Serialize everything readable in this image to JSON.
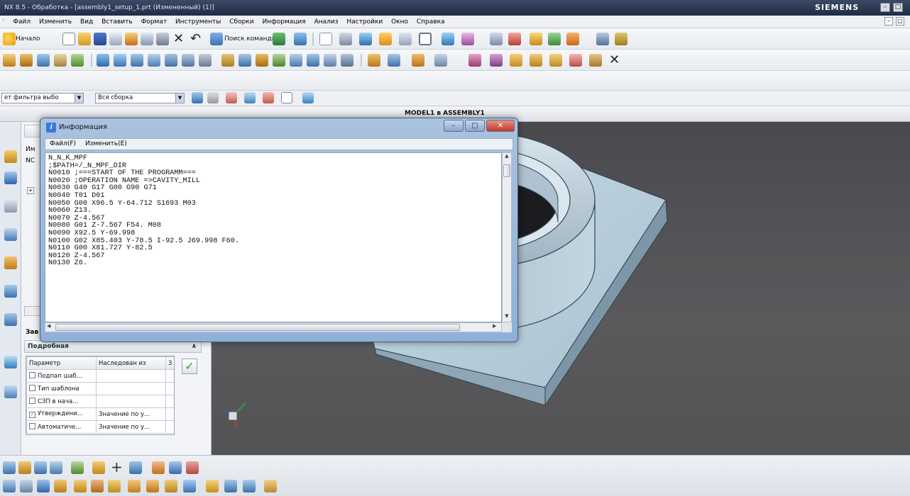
{
  "window": {
    "title": "NX 8.5 - Обработка - [assembly1_setup_1.prt (Измененный)  (1)]",
    "brand": "SIEMENS",
    "min_glyph": "–",
    "close_glyph": "✕",
    "restore_glyph": "□"
  },
  "menu": {
    "items": [
      "Файл",
      "Изменить",
      "Вид",
      "Вставить",
      "Формат",
      "Инструменты",
      "Сборки",
      "Информация",
      "Анализ",
      "Настройки",
      "Окно",
      "Справка"
    ]
  },
  "toolbar": {
    "start_label": "Начало",
    "command_search_label": "Поиск команды"
  },
  "filter_bar": {
    "filter_label": "ет фильтра выбо",
    "assembly_combo": "Вся сборка"
  },
  "viewport": {
    "title": "MODEL1 в ASSEMBLY1"
  },
  "navigator": {
    "header_partial": "Им",
    "row_partial": "NC",
    "section_partial": "Зав",
    "details_header": "Подробная",
    "collapse_glyph": "∧",
    "columns": [
      "Параметр",
      "Наследован из",
      "3"
    ],
    "rows": [
      {
        "checked": false,
        "param": "Подпап шаб...",
        "inherited": ""
      },
      {
        "checked": false,
        "param": "Тип шаблона",
        "inherited": ""
      },
      {
        "checked": false,
        "param": "СЗП в нача...",
        "inherited": ""
      },
      {
        "checked": true,
        "param": "Утверждени...",
        "inherited": "Значение по у..."
      },
      {
        "checked": false,
        "param": "Автоматиче...",
        "inherited": "Значение по у..."
      }
    ]
  },
  "info_window": {
    "title": "Информация",
    "menu": [
      "Файл(F)",
      "Изменить(E)"
    ],
    "lines": [
      "N_N_K_MPF",
      ";$PATH=/_N_MPF_DIR",
      "N0010 ;===START OF THE PROGRAMM===",
      "N0020 ;OPERATION NAME =>CAVITY_MILL",
      "N0030 G40 G17 G00 G90 G71",
      "N0040 T01 D01",
      "N0050 G00 X96.5 Y-64.712 S1693 M03",
      "N0060 Z13.",
      "N0070 Z-4.567",
      "N0080 G01 Z-7.567 F54. M08",
      "N0090 X92.5 Y-69.998",
      "N0100 G02 X85.403 Y-78.5 I-92.5 J69.998 F60.",
      "N0110 G00 X81.727 Y-82.5",
      "N0120 Z-4.567",
      "N0130 Z6."
    ]
  },
  "colors": {
    "viewport_bg": "#505053",
    "part_face": "#b9cfdc",
    "info_frame": "#9db8da",
    "close_button": "#c9453a"
  }
}
